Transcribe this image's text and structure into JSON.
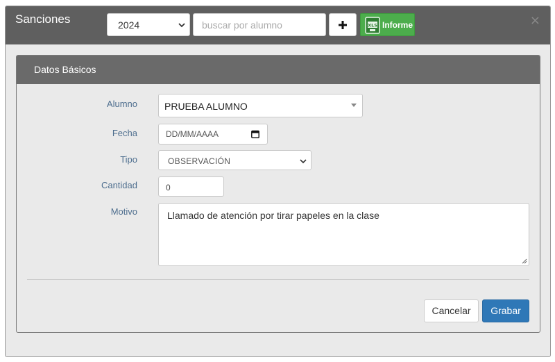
{
  "header": {
    "title": "Sanciones",
    "year": "2024",
    "search_placeholder": "buscar por alumno",
    "add_label": "+",
    "informe_label": "Informe",
    "close_label": "×"
  },
  "panel": {
    "title": "Datos Básicos"
  },
  "form": {
    "alumno_label": "Alumno",
    "alumno_value": "PRUEBA ALUMNO",
    "fecha_label": "Fecha",
    "fecha_value": "DD/MM/AAAA",
    "tipo_label": "Tipo",
    "tipo_value": "OBSERVACIÓN",
    "cantidad_label": "Cantidad",
    "cantidad_value": "0",
    "motivo_label": "Motivo",
    "motivo_value": "Llamado de atención por tirar papeles en la clase"
  },
  "footer": {
    "cancel_label": "Cancelar",
    "save_label": "Grabar"
  },
  "colors": {
    "header_bg": "#5f5f5f",
    "panel_heading_bg": "#6a6a6a",
    "informe_green": "#4cad4c",
    "save_blue": "#2f78b7",
    "label_blue": "#4f6f8f"
  }
}
